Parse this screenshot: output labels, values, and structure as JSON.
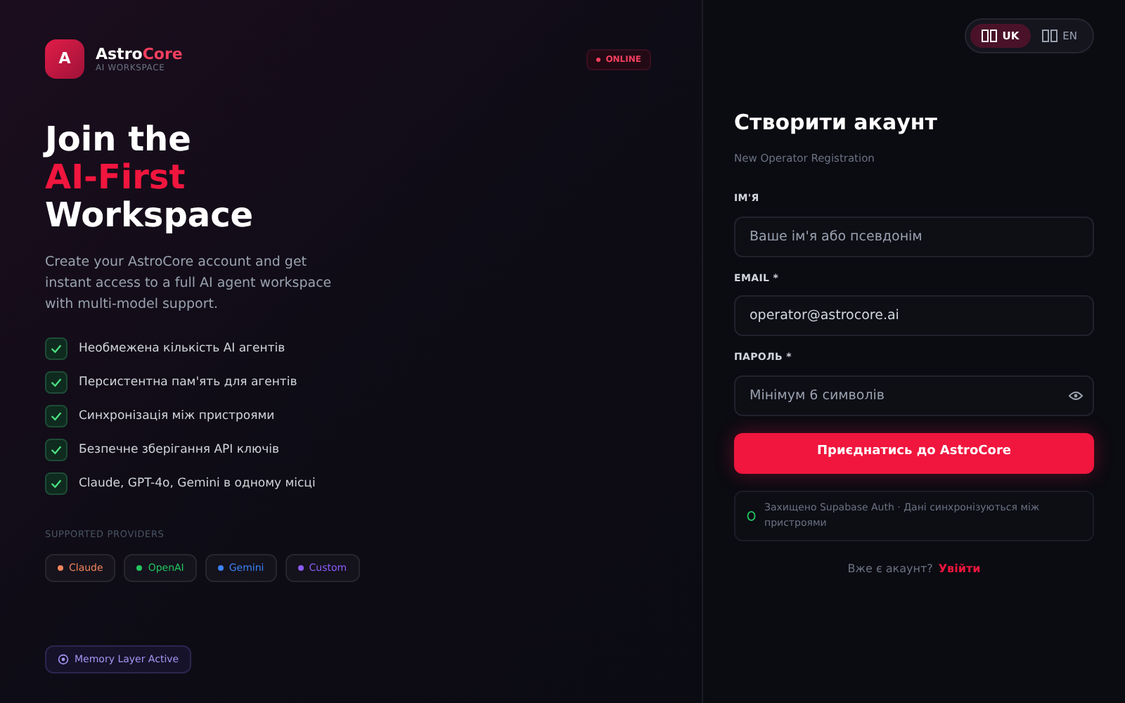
{
  "brand": {
    "name_main": "Astro",
    "name_accent": "Core",
    "subtitle": "AI WORKSPACE",
    "logo_letter": "A"
  },
  "status_badge": {
    "label": "ONLINE",
    "on": true
  },
  "hero": {
    "line1": "Join the",
    "line2": "AI-First",
    "line3": "Workspace",
    "description": "Create your AstroCore account and get instant access to a full AI agent workspace with multi-model support."
  },
  "features": [
    {
      "label": "Необмежена кількість AI агентів",
      "checked": true
    },
    {
      "label": "Персистентна пам'ять для агентів",
      "checked": true
    },
    {
      "label": "Синхронізація між пристроями",
      "checked": true
    },
    {
      "label": "Безпечне зберігання API ключів",
      "checked": true
    },
    {
      "label": "Claude, GPT-4o, Gemini в одному місці",
      "checked": true
    }
  ],
  "providers": {
    "heading": "SUPPORTED PROVIDERS",
    "items": [
      {
        "label": "Claude",
        "color": "#f0855a"
      },
      {
        "label": "OpenAI",
        "color": "#22c55e"
      },
      {
        "label": "Gemini",
        "color": "#3b82f6"
      },
      {
        "label": "Custom",
        "color": "#8b5cf6"
      }
    ]
  },
  "memory_badge": {
    "label": "Memory Layer Active"
  },
  "languages": [
    {
      "label": "UK",
      "selected": true
    },
    {
      "label": "EN",
      "selected": false
    }
  ],
  "form": {
    "title": "Створити акаунт",
    "subtitle": "New Operator Registration",
    "fields": [
      {
        "label": "ІМ'Я",
        "placeholder": "Ваше ім'я або псевдонім",
        "kind": "text"
      },
      {
        "label": "EMAIL *",
        "value": "operator@astrocore.ai",
        "kind": "text"
      },
      {
        "label": "ПАРОЛЬ *",
        "placeholder": "Мінімум 6 символів",
        "kind": "password"
      }
    ],
    "submit": "Приєднатись до AstroCore",
    "security_note": "Захищено Supabase Auth · Дані синхронізуються між пристроями",
    "login_prompt": "Вже є акаунт?",
    "login_link": "Увійти"
  }
}
